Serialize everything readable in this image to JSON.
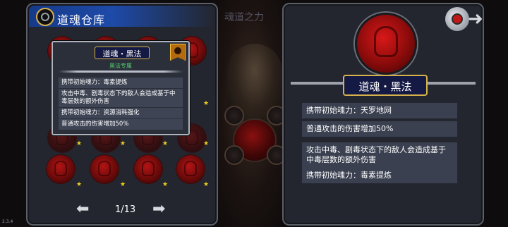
{
  "background": {
    "faded_title": "魂道之力"
  },
  "left_panel": {
    "title": "道魂仓库",
    "header_icon": "ring-emblem-icon",
    "pagination": {
      "current": "1/13",
      "prev_icon": "arrow-left-icon",
      "next_icon": "arrow-right-icon"
    }
  },
  "tooltip": {
    "title": "道魂・黑法",
    "subtitle": "黑法专属",
    "avatar_icon": "character-avatar-icon",
    "rows": [
      "携带初始魂力：毒素提炼",
      "攻击中毒、剧毒状态下的敌人会造成基于中毒层数的额外伤害",
      "携带初始魂力：资源消耗强化",
      "普通攻击的伤害增加50%"
    ]
  },
  "right_panel": {
    "title": "道魂・黑法",
    "emblem_icon": "red-hooded-face-icon",
    "rows": [
      "携带初始魂力：天罗地网",
      "普通攻击的伤害增加50%",
      "攻击中毒、剧毒状态下的敌人会造成基于中毒层数的额外伤害",
      "携带初始魂力：毒素提炼"
    ],
    "close_icon": "back-exit-icon"
  },
  "version": "2.3.4",
  "colors": {
    "header_blue": "#1e4aa8",
    "star_yellow": "#f0d020",
    "orb_red": "#b31414",
    "gold_border": "#d7b24a",
    "subtitle_green": "#58d070"
  }
}
